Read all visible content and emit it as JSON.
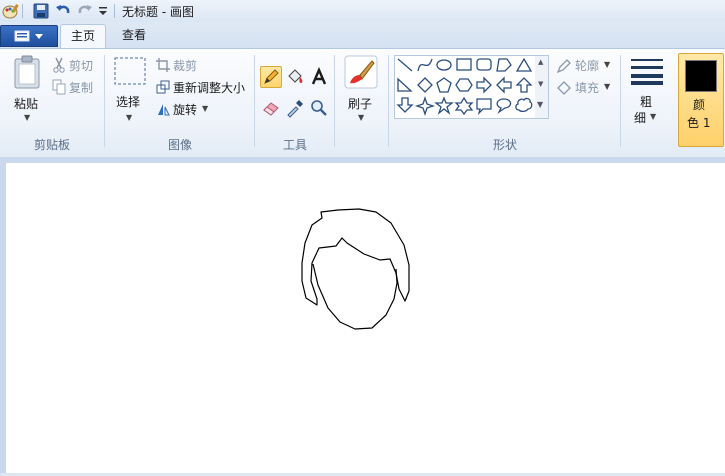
{
  "window": {
    "title": "无标题 - 画图"
  },
  "tabs": [
    {
      "label": "主页"
    },
    {
      "label": "查看"
    }
  ],
  "clipboard": {
    "paste_label": "粘贴",
    "cut_label": "剪切",
    "copy_label": "复制",
    "group_label": "剪贴板"
  },
  "image": {
    "select_label": "选择",
    "crop_label": "裁剪",
    "resize_label": "重新调整大小",
    "rotate_label": "旋转",
    "group_label": "图像"
  },
  "tools": {
    "group_label": "工具",
    "selected": "pencil-tool"
  },
  "brushes": {
    "label": "刷子"
  },
  "shapes": {
    "outline_label": "轮廓",
    "fill_label": "填充",
    "group_label": "形状"
  },
  "size": {
    "label_line1": "粗",
    "label_line2": "细"
  },
  "color1": {
    "label_line1": "颜",
    "label_line2": "色 1",
    "value": "#000000"
  },
  "colors": {
    "ribbon_accent": "#ffd56a",
    "canvas": "#ffffff",
    "file_button": "#2b5fb4"
  }
}
